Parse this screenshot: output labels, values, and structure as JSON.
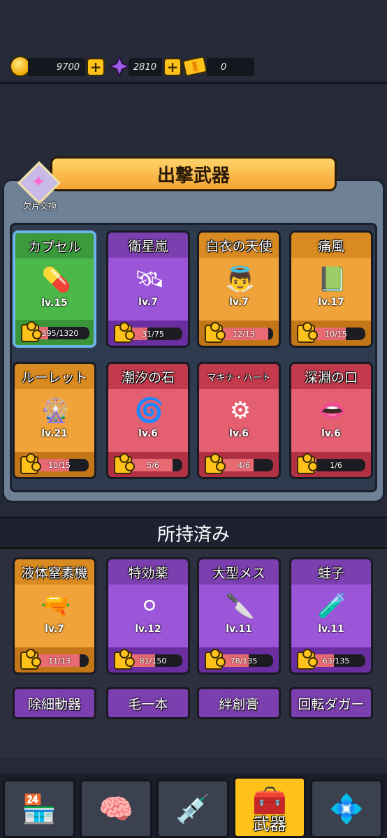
{
  "resources": {
    "coins": "9700",
    "gems": "2810",
    "tickets": "0"
  },
  "panel": {
    "title": "出撃武器",
    "exchange_label": "欠片交換"
  },
  "equipped": [
    {
      "name": "カプセル",
      "level": "lv.15",
      "progress": "395/1320",
      "fraction": 0.3,
      "color": "green",
      "icon": "capsule-icon"
    },
    {
      "name": "衛星嵐",
      "level": "lv.7",
      "progress": "31/75",
      "fraction": 0.41,
      "color": "purple",
      "icon": "satellite-icon"
    },
    {
      "name": "白衣の天使",
      "level": "lv.7",
      "progress": "12/13",
      "fraction": 0.92,
      "color": "orange",
      "icon": "nurse-angel-icon"
    },
    {
      "name": "痛風",
      "level": "lv.17",
      "progress": "10/15",
      "fraction": 0.67,
      "color": "orange",
      "icon": "medicine-box-icon"
    },
    {
      "name": "ルーレット",
      "level": "lv.21",
      "progress": "10/15",
      "fraction": 0.67,
      "color": "orange",
      "icon": "roulette-icon"
    },
    {
      "name": "潮汐の石",
      "level": "lv.6",
      "progress": "5/6",
      "fraction": 0.83,
      "color": "red",
      "icon": "tide-stone-icon"
    },
    {
      "name": "マキナ・ハート",
      "level": "lv.6",
      "progress": "4/6",
      "fraction": 0.67,
      "color": "red",
      "icon": "machina-heart-icon"
    },
    {
      "name": "深淵の口",
      "level": "lv.6",
      "progress": "1/6",
      "fraction": 0.17,
      "color": "red",
      "icon": "abyss-mouth-icon"
    }
  ],
  "owned_header": "所持済み",
  "owned": [
    {
      "name": "液体窒素機",
      "level": "lv.7",
      "progress": "11/13",
      "fraction": 0.85,
      "color": "orange",
      "icon": "nitrogen-gun-icon"
    },
    {
      "name": "特効薬",
      "level": "lv.12",
      "progress": "81/150",
      "fraction": 0.54,
      "color": "purple",
      "icon": "pill-icon"
    },
    {
      "name": "大型メス",
      "level": "lv.11",
      "progress": "78/135",
      "fraction": 0.58,
      "color": "purple",
      "icon": "scalpel-icon"
    },
    {
      "name": "蛙子",
      "level": "lv.11",
      "progress": "63/135",
      "fraction": 0.47,
      "color": "purple",
      "icon": "test-tube-icon"
    }
  ],
  "owned_more": [
    "除細動器",
    "毛一本",
    "絆創膏",
    "回転ダガー"
  ],
  "nav": {
    "active_label": "武器"
  },
  "colors": {
    "accent": "#ffc21a",
    "progress_fill": "#e86a73"
  }
}
